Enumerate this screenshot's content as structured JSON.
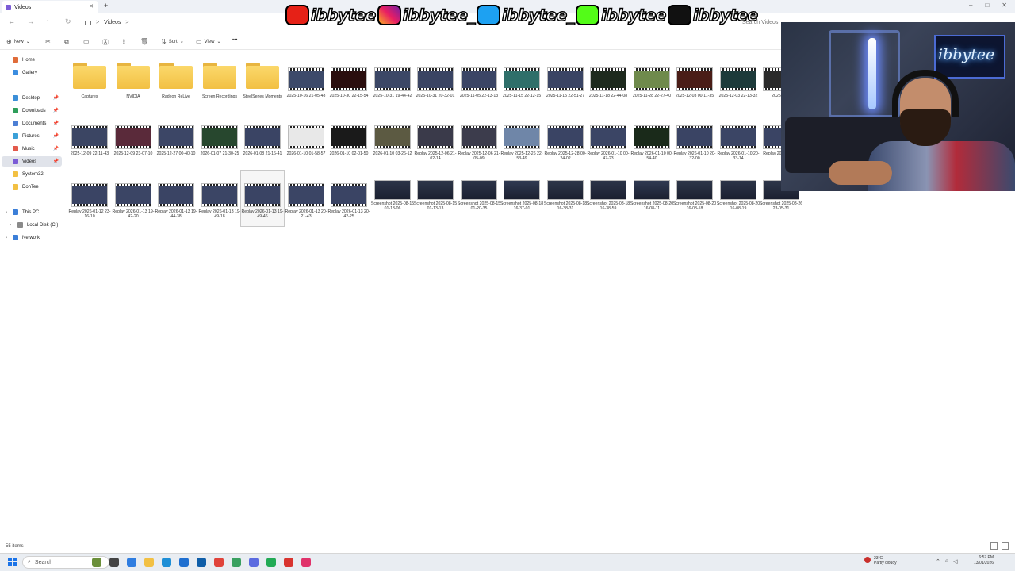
{
  "window": {
    "tab_title": "Videos",
    "new_tab": "+",
    "controls": [
      "–",
      "□",
      "✕"
    ]
  },
  "nav": {
    "back": "←",
    "forward": "→",
    "up": "↑",
    "refresh": "↻",
    "breadcrumb": [
      "Videos"
    ],
    "separator": ">",
    "search_placeholder": "Search Videos"
  },
  "commands": {
    "new": "New",
    "sort": "Sort",
    "view": "View",
    "more": "•••"
  },
  "sidebar": [
    {
      "label": "Home",
      "color": "#e06c3a",
      "pin": false,
      "selected": false
    },
    {
      "label": "Gallery",
      "color": "#3b8de0",
      "pin": false,
      "selected": false
    },
    {
      "label": "Desktop",
      "color": "#3c8fd8",
      "pin": true,
      "selected": false
    },
    {
      "label": "Downloads",
      "color": "#2f9e5b",
      "pin": true,
      "selected": false
    },
    {
      "label": "Documents",
      "color": "#4c7fd4",
      "pin": true,
      "selected": false
    },
    {
      "label": "Pictures",
      "color": "#3aa0d8",
      "pin": true,
      "selected": false
    },
    {
      "label": "Music",
      "color": "#e35a4c",
      "pin": true,
      "selected": false
    },
    {
      "label": "Videos",
      "color": "#7b5cd6",
      "pin": true,
      "selected": true
    },
    {
      "label": "System32",
      "color": "#f2c043",
      "pin": false,
      "selected": false
    },
    {
      "label": "DonTee",
      "color": "#f2c043",
      "pin": false,
      "selected": false
    },
    {
      "label": "This PC",
      "color": "#3c7fd8",
      "pin": false,
      "selected": false,
      "expander": "›"
    },
    {
      "label": "Local Disk (C:)",
      "color": "#8a8a8a",
      "pin": false,
      "selected": false,
      "expander": "›"
    },
    {
      "label": "Network",
      "color": "#3c7fd8",
      "pin": false,
      "selected": false,
      "expander": "›"
    }
  ],
  "items": [
    {
      "type": "folder",
      "name": "Captures"
    },
    {
      "type": "folder",
      "name": "NVIDIA"
    },
    {
      "type": "folder",
      "name": "Radeon ReLive"
    },
    {
      "type": "folder",
      "name": "Screen Recordings"
    },
    {
      "type": "folder",
      "name": "SteelSeries Moments"
    },
    {
      "type": "video",
      "name": "2025-10-16 21-05-48",
      "thumb": "#3d4a6a"
    },
    {
      "type": "video",
      "name": "2025-10-30 22-15-54",
      "thumb": "#2a0e0e"
    },
    {
      "type": "video",
      "name": "2025-10-31 19-44-42",
      "thumb": "#3c4766"
    },
    {
      "type": "video",
      "name": "2025-10-31 20-32-01",
      "thumb": "#3a4463"
    },
    {
      "type": "video",
      "name": "2025-11-05 22-13-13",
      "thumb": "#3b4565"
    },
    {
      "type": "video",
      "name": "2025-11-15 22-12-15",
      "thumb": "#2f6f6a"
    },
    {
      "type": "video",
      "name": "2025-11-15 22-51-27",
      "thumb": "#3a4464"
    },
    {
      "type": "video",
      "name": "2025-11-18 22-44-08",
      "thumb": "#1e2a1e"
    },
    {
      "type": "video",
      "name": "2025-11-28 22-27-40",
      "thumb": "#6f8a4c"
    },
    {
      "type": "video",
      "name": "2025-12-03 00-11-35",
      "thumb": "#4a1d17"
    },
    {
      "type": "video",
      "name": "2025-12-03 22-13-32",
      "thumb": "#1d3a3a"
    },
    {
      "type": "video",
      "name": "2025-12-0",
      "thumb": "#2a2a2a"
    },
    {
      "type": "video",
      "name": "2025-12-09 22-11-43",
      "thumb": "#3b4563"
    },
    {
      "type": "video",
      "name": "2025-12-09 23-07-10",
      "thumb": "#5a2a3a"
    },
    {
      "type": "video",
      "name": "2025-12-27 00-40-10",
      "thumb": "#3c4666"
    },
    {
      "type": "video",
      "name": "2026-01-07 21-30-25",
      "thumb": "#27472e"
    },
    {
      "type": "video",
      "name": "2026-01-08 21-16-41",
      "thumb": "#3a4464"
    },
    {
      "type": "video",
      "name": "2026-01-10 01-58-57",
      "thumb": "#e8e8e8"
    },
    {
      "type": "video",
      "name": "2026-01-10 02-01-50",
      "thumb": "#1a1a1a"
    },
    {
      "type": "video",
      "name": "2026-01-10 03-26-12",
      "thumb": "#5c5a42"
    },
    {
      "type": "video",
      "name": "Replay 2025-12-06 21-02-14",
      "thumb": "#3a3a4a"
    },
    {
      "type": "video",
      "name": "Replay 2025-12-06 21-05-09",
      "thumb": "#3c3c4c"
    },
    {
      "type": "video",
      "name": "Replay 2025-12-26 22-53-49",
      "thumb": "#6f86a8"
    },
    {
      "type": "video",
      "name": "Replay 2025-12-28 00-24-02",
      "thumb": "#3a4464"
    },
    {
      "type": "video",
      "name": "Replay 2026-01-10 00-47-23",
      "thumb": "#3b4565"
    },
    {
      "type": "video",
      "name": "Replay 2026-01-10 00-54-40",
      "thumb": "#1a2a1a"
    },
    {
      "type": "video",
      "name": "Replay 2026-01-10 20-32-00",
      "thumb": "#3a4464"
    },
    {
      "type": "video",
      "name": "Replay 2026-01-10 20-33-14",
      "thumb": "#3b4565"
    },
    {
      "type": "video",
      "name": "Replay 2026-0 20-4",
      "thumb": "#3a4464"
    },
    {
      "type": "video",
      "name": "Replay 2026-01-12 23-16-10",
      "thumb": "#3a4464"
    },
    {
      "type": "video",
      "name": "Replay 2026-01-13 19-42-20",
      "thumb": "#3b4565"
    },
    {
      "type": "video",
      "name": "Replay 2026-01-13 19-44-38",
      "thumb": "#3a4464"
    },
    {
      "type": "video",
      "name": "Replay 2026-01-13 19-49-18",
      "thumb": "#3b4565"
    },
    {
      "type": "video",
      "name": "Replay 2026-01-13 19-49-46",
      "thumb": "#3a4464",
      "selected": true
    },
    {
      "type": "video",
      "name": "Replay 2026-01-13 20-21-43",
      "thumb": "#3b4565"
    },
    {
      "type": "video",
      "name": "Replay 2026-01-13 20-42-25",
      "thumb": "#3a4464"
    },
    {
      "type": "shot",
      "name": "Screenshot 2025-08-15 01-13-06",
      "thumb": "#2c3448"
    },
    {
      "type": "shot",
      "name": "Screenshot 2025-08-15 01-13-13",
      "thumb": "#2e3649"
    },
    {
      "type": "shot",
      "name": "Screenshot 2025-08-15 01-20-35",
      "thumb": "#2c3448"
    },
    {
      "type": "shot",
      "name": "Screenshot 2025-08-18 16-37-01",
      "thumb": "#303a52"
    },
    {
      "type": "shot",
      "name": "Screenshot 2025-08-18 16-38-31",
      "thumb": "#2e3649"
    },
    {
      "type": "shot",
      "name": "Screenshot 2025-08-18 16-38-59",
      "thumb": "#2c3448"
    },
    {
      "type": "shot",
      "name": "Screenshot 2025-08-20 16-08-11",
      "thumb": "#303a52"
    },
    {
      "type": "shot",
      "name": "Screenshot 2025-08-20 16-08-18",
      "thumb": "#2e3649"
    },
    {
      "type": "shot",
      "name": "Screenshot 2025-08-20 16-08-19",
      "thumb": "#2c3448"
    },
    {
      "type": "shot",
      "name": "Screenshot 2025-08-26 23-05-31",
      "thumb": "#2e3649"
    }
  ],
  "status": {
    "count": "55 items"
  },
  "taskbar": {
    "search_label": "Search",
    "weather_temp": "23°C",
    "weather_desc": "Partly cloudy",
    "time": "6:57 PM",
    "date": "13/01/2026",
    "apps": [
      "#6b8f3a",
      "#444444",
      "#2f7de0",
      "#f2c043",
      "#1f8fd6",
      "#1f6fd0",
      "#0f5ea8",
      "#e0433a",
      "#3aa060",
      "#5b6be0",
      "#22aa55",
      "#d8342f",
      "#e0336b"
    ]
  },
  "overlay": {
    "handles": [
      {
        "platform": "youtube-icon",
        "color": "#e62117",
        "text": "ibbytee"
      },
      {
        "platform": "instagram-icon",
        "color": "#d6249f",
        "text": "ibbytee_"
      },
      {
        "platform": "twitter-icon",
        "color": "#1da1f2",
        "text": "ibbytee_"
      },
      {
        "platform": "kick-icon",
        "color": "#53fc18",
        "text": "ibbytee"
      },
      {
        "platform": "tiktok-icon",
        "color": "#111111",
        "text": "ibbytee"
      }
    ],
    "neon_sign": "ibbytee"
  }
}
